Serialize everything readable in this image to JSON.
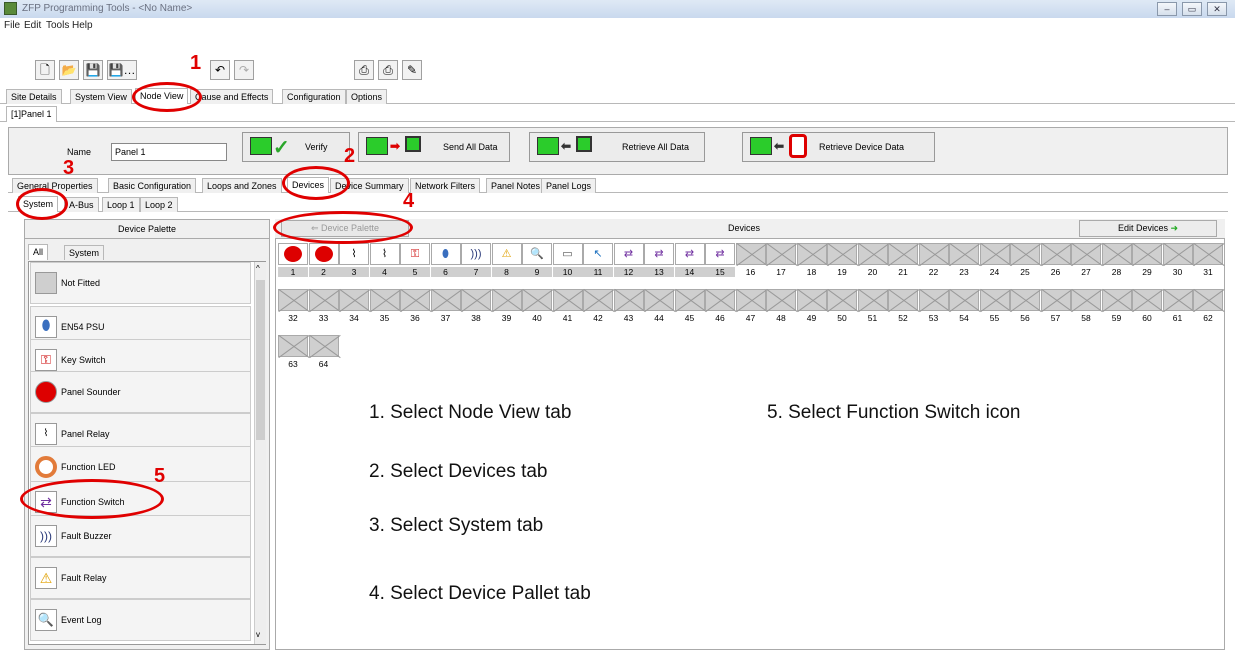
{
  "window": {
    "title": "ZFP Programming Tools - <No Name>"
  },
  "menu": [
    "File",
    "Edit",
    "Tools",
    "Help"
  ],
  "main_tabs": [
    "Site Details",
    "System View",
    "Node View",
    "Cause and Effects",
    "Configuration",
    "Options"
  ],
  "panel_tab": "[1]Panel 1",
  "name_field": {
    "label": "Name",
    "value": "Panel 1"
  },
  "actions": {
    "verify": "Verify",
    "send": "Send All Data",
    "retrieve": "Retrieve All Data",
    "retrieve_device": "Retrieve Device Data"
  },
  "sub_tabs": [
    "General Properties",
    "Basic Configuration",
    "Loops and Zones",
    "Devices",
    "Device Summary",
    "Network Filters",
    "Panel Notes",
    "Panel Logs"
  ],
  "loop_tabs": [
    "System",
    "A-Bus",
    "Loop 1",
    "Loop 2"
  ],
  "palette": {
    "header": "Device Palette",
    "tabs": [
      "All",
      "System"
    ],
    "items": [
      "Not Fitted",
      "EN54 PSU",
      "Key Switch",
      "Panel Sounder",
      "Panel Relay",
      "Function LED",
      "Function Switch",
      "Fault Buzzer",
      "Fault Relay",
      "Event Log"
    ]
  },
  "devices": {
    "palette_button": "Device Palette",
    "header": "Devices",
    "edit_button": "Edit Devices",
    "row1": [
      "1",
      "2",
      "3",
      "4",
      "5",
      "6",
      "7",
      "8",
      "9",
      "10",
      "11",
      "12",
      "13",
      "14",
      "15",
      "16",
      "17",
      "18",
      "19",
      "20",
      "21",
      "22",
      "23",
      "24",
      "25",
      "26",
      "27",
      "28",
      "29",
      "30",
      "31"
    ],
    "row2": [
      "32",
      "33",
      "34",
      "35",
      "36",
      "37",
      "38",
      "39",
      "40",
      "41",
      "42",
      "43",
      "44",
      "45",
      "46",
      "47",
      "48",
      "49",
      "50",
      "51",
      "52",
      "53",
      "54",
      "55",
      "56",
      "57",
      "58",
      "59",
      "60",
      "61",
      "62"
    ],
    "row3": [
      "63",
      "64"
    ]
  },
  "annotations": {
    "markers": [
      "1",
      "2",
      "3",
      "4",
      "5"
    ],
    "steps": [
      "1.  Select Node View tab",
      "2.  Select Devices tab",
      "3.  Select System tab",
      "4.  Select Device Pallet tab",
      "5.  Select Function Switch icon"
    ]
  },
  "colors": {
    "annotation_red": "#e00000"
  }
}
